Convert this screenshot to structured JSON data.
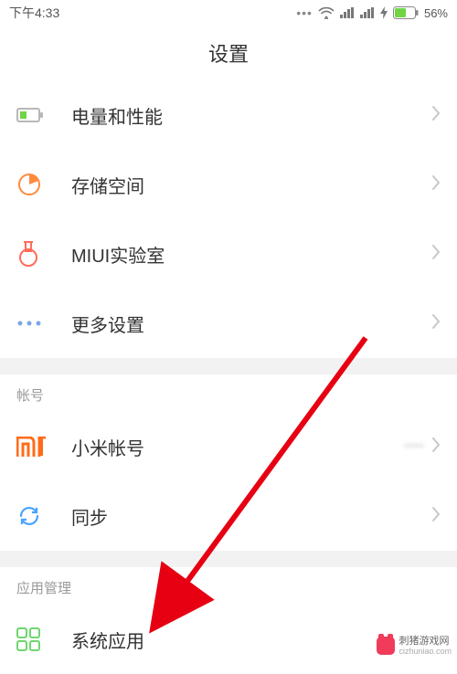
{
  "statusBar": {
    "time": "下午4:33",
    "battery": "56%"
  },
  "header": {
    "title": "设置"
  },
  "groups": [
    {
      "items": [
        {
          "icon": "battery-icon",
          "label": "电量和性能"
        },
        {
          "icon": "storage-icon",
          "label": "存储空间"
        },
        {
          "icon": "lab-icon",
          "label": "MIUI实验室"
        },
        {
          "icon": "more-icon",
          "label": "更多设置"
        }
      ]
    },
    {
      "header": "帐号",
      "items": [
        {
          "icon": "mi-icon",
          "label": "小米帐号",
          "value": "••••"
        },
        {
          "icon": "sync-icon",
          "label": "同步"
        }
      ]
    },
    {
      "header": "应用管理",
      "items": [
        {
          "icon": "apps-icon",
          "label": "系统应用"
        }
      ]
    }
  ],
  "watermark": {
    "title": "刺猪游戏网",
    "sub": "cizhuniao.com"
  },
  "colors": {
    "accent": "#ff6b1a",
    "battery_green": "#70d445",
    "arrow_red": "#e60012",
    "icon_gray": "#b8b8b8",
    "sync_blue": "#4aa3ff"
  }
}
